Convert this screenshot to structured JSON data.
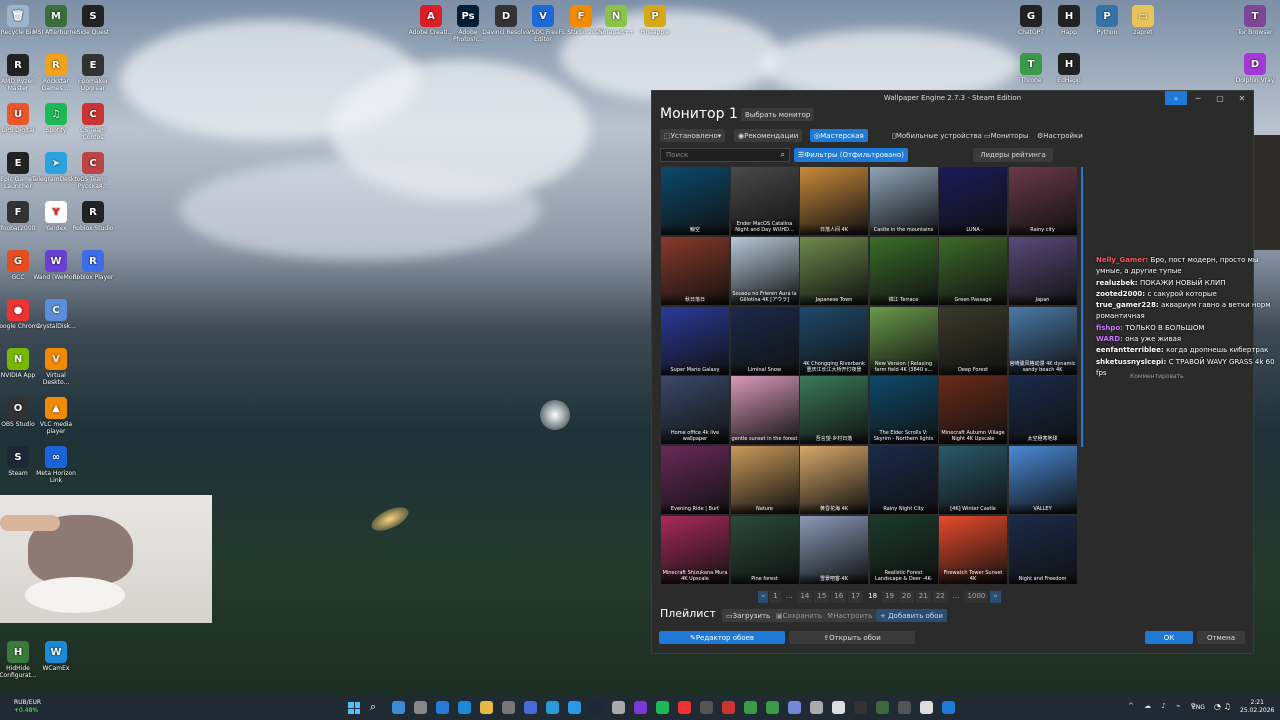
{
  "desktop_icons": [
    {
      "label": "Recycle Bin",
      "color": "#9bb6cc",
      "glyph": "🗑"
    },
    {
      "label": "MSI Afterburner",
      "color": "#3b6e3a",
      "glyph": "M"
    },
    {
      "label": "Side Quest",
      "color": "#222",
      "glyph": "S"
    },
    {
      "label": "AMD Ryzen Master",
      "color": "#222",
      "glyph": "R"
    },
    {
      "label": "Rockstar Games ...",
      "color": "#f3a21b",
      "glyph": "R"
    },
    {
      "label": "Epomaker Upgrear",
      "color": "#333",
      "glyph": "E"
    },
    {
      "label": "UPS Digital",
      "color": "#e9572a",
      "glyph": "U"
    },
    {
      "label": "Spotify",
      "color": "#1db954",
      "glyph": "♫"
    },
    {
      "label": "CS Team Contos",
      "color": "#c33",
      "glyph": "C"
    },
    {
      "label": "Epic Games Launcher",
      "color": "#222",
      "glyph": "E"
    },
    {
      "label": "TelegramDesktop",
      "color": "#2aa3df",
      "glyph": "➤"
    },
    {
      "label": "CS Team Русская...",
      "color": "#b44",
      "glyph": "C"
    },
    {
      "label": "foobar2000",
      "color": "#333",
      "glyph": "F"
    },
    {
      "label": "Yandex",
      "color": "#fff",
      "glyph": "Y"
    },
    {
      "label": "Roblox Studio",
      "color": "#222",
      "glyph": "R"
    },
    {
      "label": "GCC",
      "color": "#e64c1e",
      "glyph": "G"
    },
    {
      "label": "Wand (WeMod)",
      "color": "#6a3fd6",
      "glyph": "W"
    },
    {
      "label": "Roblox Player",
      "color": "#3d6ee8",
      "glyph": "R"
    },
    {
      "label": "Google Chrome",
      "color": "#e33",
      "glyph": "●"
    },
    {
      "label": "CrystalDisk...",
      "color": "#5a8fd8",
      "glyph": "C"
    },
    {
      "label": "NVIDIA App",
      "color": "#76b900",
      "glyph": "N"
    },
    {
      "label": "Virtual Deskto...",
      "color": "#f28b00",
      "glyph": "V"
    },
    {
      "label": "OBS Studio",
      "color": "#333",
      "glyph": "O"
    },
    {
      "label": "VLC media player",
      "color": "#f28b00",
      "glyph": "▲"
    },
    {
      "label": "Steam",
      "color": "#1b2838",
      "glyph": "S"
    },
    {
      "label": "Meta Horizon Link",
      "color": "#1b63d8",
      "glyph": "∞"
    },
    {
      "label": "HidHide Configurat...",
      "color": "#3a7a3a",
      "glyph": "H"
    },
    {
      "label": "WCamEx",
      "color": "#1b8ad8",
      "glyph": "W"
    },
    {
      "label": "Adobe Creati...",
      "color": "#da1f26",
      "glyph": "A"
    },
    {
      "label": "Adobe Photosh...",
      "color": "#001e36",
      "glyph": "Ps"
    },
    {
      "label": "Davinci Resolve",
      "color": "#333",
      "glyph": "D"
    },
    {
      "label": "VSDC Free Editor",
      "color": "#1b6ad8",
      "glyph": "V"
    },
    {
      "label": "FL Studio 2025",
      "color": "#f28b00",
      "glyph": "F"
    },
    {
      "label": "Notepad++",
      "color": "#8bc34a",
      "glyph": "N"
    },
    {
      "label": "Pineapple",
      "color": "#d8a81b",
      "glyph": "P"
    },
    {
      "label": "ChatGPT",
      "color": "#222",
      "glyph": "G"
    },
    {
      "label": "Happ",
      "color": "#222",
      "glyph": "H"
    },
    {
      "label": "Python",
      "color": "#3572a5",
      "glyph": "P"
    },
    {
      "label": "zapret",
      "color": "#e8c35a",
      "glyph": "▭"
    },
    {
      "label": "Tor Browser",
      "color": "#7d4698",
      "glyph": "T"
    },
    {
      "label": "Throne",
      "color": "#3a9a4a",
      "glyph": "T"
    },
    {
      "label": "EdHapp",
      "color": "#222",
      "glyph": "H"
    },
    {
      "label": "Dolphin Vray",
      "color": "#a33ad8",
      "glyph": "D"
    }
  ],
  "window": {
    "title": "Wallpaper Engine 2.7.3 - Steam Edition",
    "monitor_title": "Монитор 1",
    "choose_monitor": "Выбрать монитор",
    "tabs": [
      "Установлено",
      "Рекомендации",
      "Мастерская"
    ],
    "right_tabs": [
      "Мобильные устройства",
      "Мониторы",
      "Настройки"
    ],
    "search_placeholder": "Поиск",
    "filters": "Фильтры (Отфильтровано)",
    "leaders": "Лидеры рейтинга",
    "grid": [
      [
        "鯨空",
        "Ender MacOS Catalina Night and Day WUHD...",
        "日落人间 4K",
        "Castle in the mountains",
        "LUNA",
        "Rainy city"
      ],
      [
        "秋日落日",
        "Sousou no Frieren Aura la Gillotina 4K [アウラ]",
        "Japanese Town",
        "锦江 Terrace",
        "Green Passage",
        "Japan"
      ],
      [
        "Super Mario Galaxy",
        "Liminal Snow",
        "4K Chongqing Riverbank 重庆江长江大桥开灯夜景",
        "New Version | Relaxing farm field 4K (3840 x...",
        "Deep Forest",
        "宫崎骏风格动漫 4K dynamic sandy beach 4K"
      ],
      [
        "Home office 4k live wallpaper",
        "gentle sunset in the forest",
        "吾言望·乡村日落",
        "The Elder Scrolls V: Skyrim - Northern lights",
        "Minecraft Autumn Village Night 4K Upscale",
        "太空極寒地球"
      ],
      [
        "Evening Ride | Burt",
        "Nature",
        "黄昏花海 4K",
        "Rainy Night City",
        "[4K] Winter Castle",
        "VALLEY"
      ],
      [
        "Minecraft Shizukana Mura 4K Upscale",
        "Pine forest",
        "雪景吧客·4K",
        "Realistic Forest Landscape & Deer -4K-",
        "Firewatch Tower Sunset 4K",
        "Night and Freedom"
      ]
    ],
    "pagination": [
      "«",
      "1",
      "...",
      "14",
      "15",
      "16",
      "17",
      "18",
      "19",
      "20",
      "21",
      "22",
      "...",
      "1000",
      "»"
    ],
    "playlist_label": "Плейлист",
    "playlist_buttons": [
      "Загрузить",
      "Сохранить",
      "Настроить",
      "+ Добавить обои"
    ],
    "editor_button": "Редактор обоев",
    "open_button": "Открыть обои",
    "ok": "ОК",
    "cancel": "Отмена"
  },
  "chat": [
    {
      "user": "Nelly_Gamer",
      "text": "Бро, пост модерн, просто мы умные, а другие тупые",
      "color": "#f55"
    },
    {
      "user": "realuzbek",
      "text": "ПОКАЖИ НОВЫЙ КЛИП",
      "color": "#fff"
    },
    {
      "user": "zooted2000",
      "text": "с сакурой которые",
      "color": "#fff"
    },
    {
      "user": "true_gamer228",
      "text": "аквариум гавно а ветки норм романтичная",
      "color": "#fff"
    },
    {
      "user": "fishpo",
      "text": "ТОЛЬКО В БОЛЬШОМ",
      "color": "#c7f"
    },
    {
      "user": "WARD",
      "text": "она уже живая",
      "color": "#c7f"
    },
    {
      "user": "eenfantterriblee",
      "text": "когда дропнешь кибертрак",
      "color": "#fff"
    },
    {
      "user": "shketussnyslcepi",
      "text": "С ТРАВОЙ WAVY GRASS 4k 60 fps",
      "color": "#fff"
    }
  ],
  "chat_comment": "Комментировать",
  "tray": {
    "currency": "RUB/EUR",
    "change": "+0.48%",
    "lang": "ENG",
    "time": "2:21",
    "date": "25.02.2026"
  }
}
